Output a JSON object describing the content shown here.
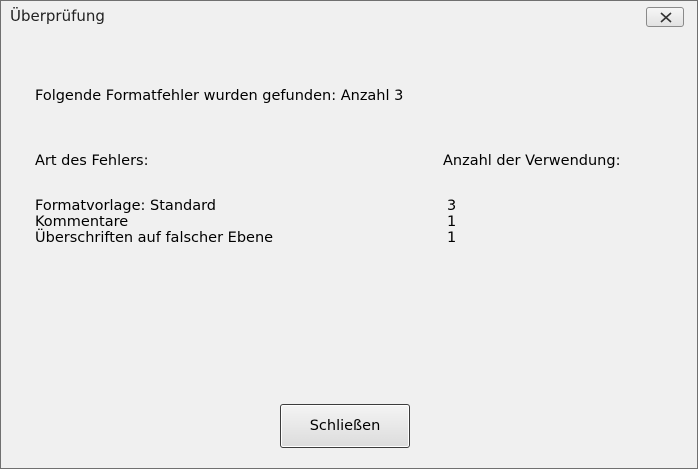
{
  "window": {
    "title": "Überprüfung",
    "close_icon": "close-icon"
  },
  "dialog": {
    "summary": "Folgende Formatfehler wurden gefunden: Anzahl 3",
    "column_headers": {
      "type": "Art des Fehlers:",
      "count": "Anzahl der Verwendung:"
    },
    "rows": [
      {
        "name": "Formatvorlage: Standard",
        "count": "3"
      },
      {
        "name": "Kommentare",
        "count": "1"
      },
      {
        "name": "Überschriften auf falscher Ebene",
        "count": "1"
      }
    ],
    "close_button_label": "Schließen"
  }
}
